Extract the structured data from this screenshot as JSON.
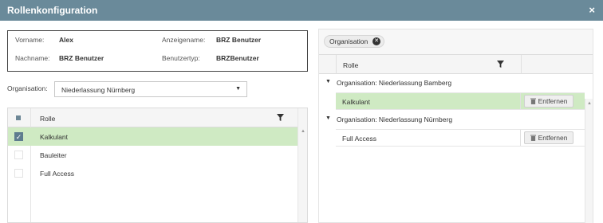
{
  "dialog": {
    "title": "Rollenkonfiguration",
    "close_glyph": "×"
  },
  "user": {
    "vorname_label": "Vorname:",
    "vorname": "Alex",
    "anzeigename_label": "Anzeigename:",
    "anzeigename": "BRZ Benutzer",
    "nachname_label": "Nachname:",
    "nachname": "BRZ Benutzer",
    "benutzertyp_label": "Benutzertyp:",
    "benutzertyp": "BRZBenutzer"
  },
  "organisation_filter": {
    "label": "Organisation:",
    "selected": "Niederlassung Nürnberg"
  },
  "left_grid": {
    "header": "Rolle",
    "rows": [
      {
        "label": "Kalkulant",
        "checked": true,
        "selected": true
      },
      {
        "label": "Bauleiter",
        "checked": false,
        "selected": false
      },
      {
        "label": "Full Access",
        "checked": false,
        "selected": false
      }
    ]
  },
  "right_panel": {
    "group_chip": "Organisation",
    "header": "Rolle",
    "remove_label": "Entfernen",
    "groups": [
      {
        "title": "Organisation: Niederlassung Bamberg",
        "roles": [
          {
            "label": "Kalkulant",
            "selected": true
          }
        ]
      },
      {
        "title": "Organisation: Niederlassung Nürnberg",
        "roles": [
          {
            "label": "Full Access",
            "selected": false
          }
        ]
      }
    ]
  },
  "colors": {
    "titlebar": "#6a8a9a",
    "selected_row": "#cfeac3",
    "checkbox": "#5e7c8e"
  },
  "icons": {
    "close": "close-icon",
    "dropdown": "caret-down-icon",
    "filter": "filter-icon",
    "remove": "trash-icon",
    "group_toggle": "triangle-down-icon",
    "chip_remove": "circle-x-icon"
  }
}
